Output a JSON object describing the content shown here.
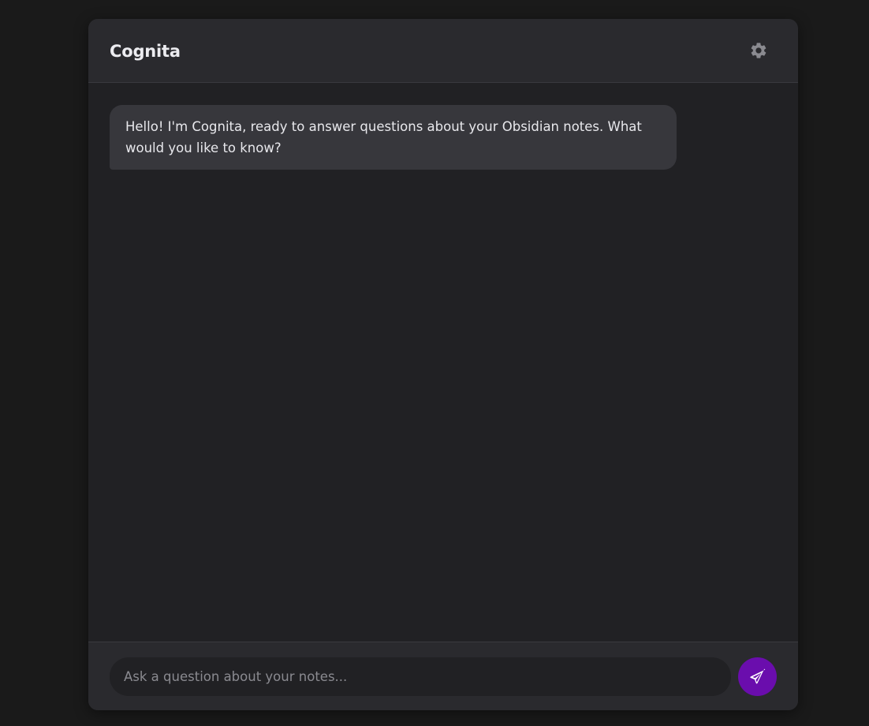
{
  "app": {
    "title": "Cognita"
  },
  "header": {
    "settings_icon": "gear-icon"
  },
  "messages": [
    {
      "role": "assistant",
      "text": "Hello! I'm Cognita, ready to answer questions about your Obsidian notes. What would you like to know?"
    }
  ],
  "composer": {
    "placeholder": "Ask a question about your notes...",
    "value": "",
    "send_icon": "paper-plane-icon"
  },
  "colors": {
    "background": "#1a1a1a",
    "panel": "#212124",
    "header": "#2a2a2e",
    "bubble": "#37373c",
    "accent": "#6a0dad",
    "icon_gray": "#8a8a90"
  }
}
